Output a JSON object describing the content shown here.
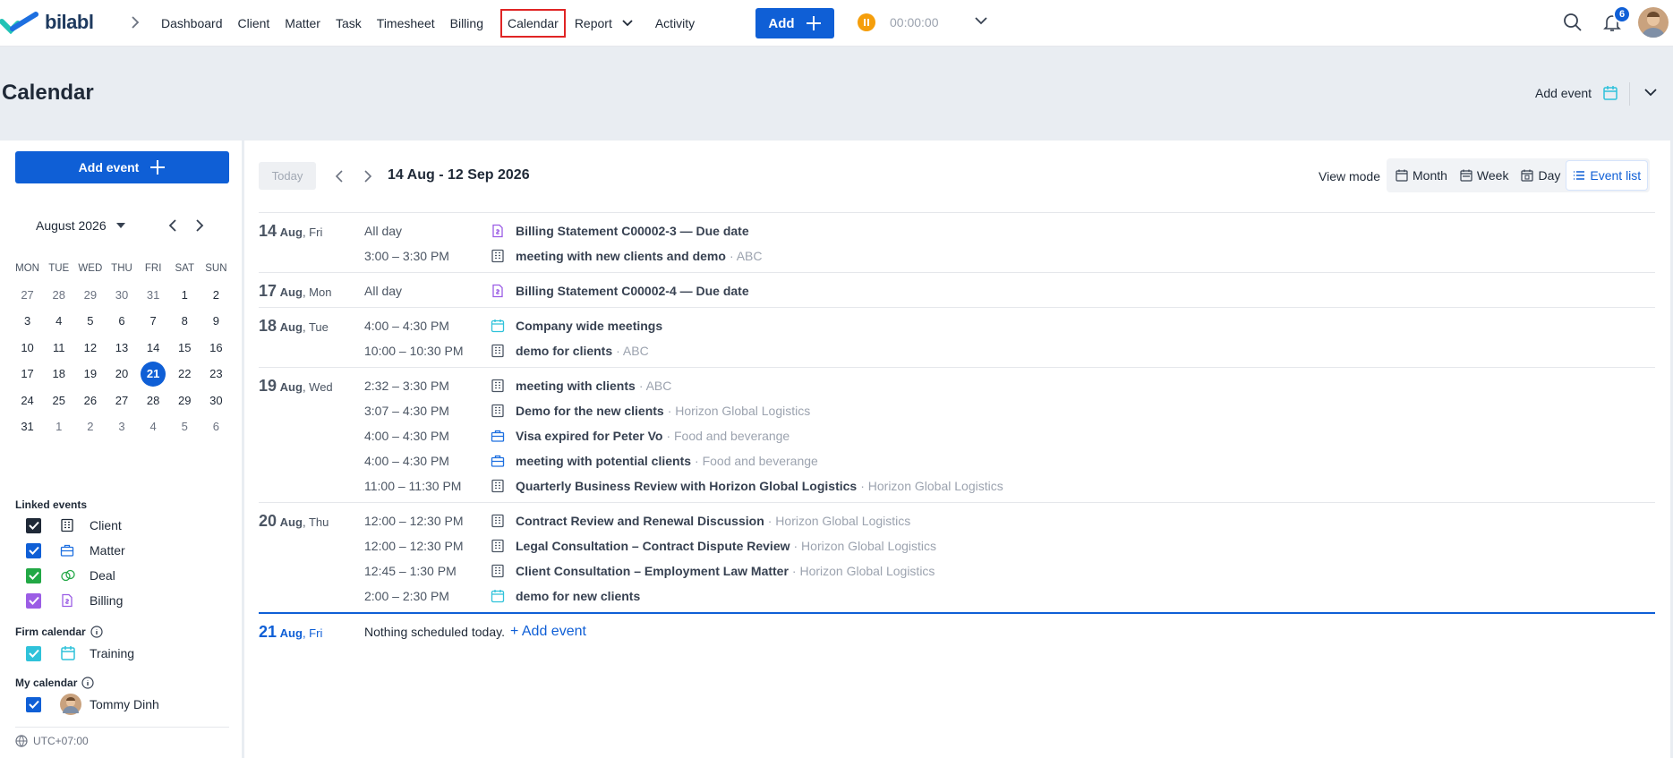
{
  "app": {
    "logo_text": "bilabl"
  },
  "nav": {
    "items": [
      {
        "label": "Dashboard"
      },
      {
        "label": "Client"
      },
      {
        "label": "Matter"
      },
      {
        "label": "Task"
      },
      {
        "label": "Timesheet"
      },
      {
        "label": "Billing"
      },
      {
        "label": "Calendar",
        "active": true
      },
      {
        "label": "Report",
        "has_dropdown": true
      },
      {
        "label": "Activity"
      }
    ],
    "add_label": "Add",
    "timer": "00:00:00",
    "notification_count": "6"
  },
  "page": {
    "title": "Calendar",
    "header_add_event": "Add event"
  },
  "sidebar": {
    "add_event_label": "Add event",
    "mini_calendar": {
      "month_label": "August 2026",
      "weekdays": [
        "MON",
        "TUE",
        "WED",
        "THU",
        "FRI",
        "SAT",
        "SUN"
      ],
      "weeks": [
        [
          "27",
          "28",
          "29",
          "30",
          "31",
          "1",
          "2"
        ],
        [
          "3",
          "4",
          "5",
          "6",
          "7",
          "8",
          "9"
        ],
        [
          "10",
          "11",
          "12",
          "13",
          "14",
          "15",
          "16"
        ],
        [
          "17",
          "18",
          "19",
          "20",
          "21",
          "22",
          "23"
        ],
        [
          "24",
          "25",
          "26",
          "27",
          "28",
          "29",
          "30"
        ],
        [
          "31",
          "1",
          "2",
          "3",
          "4",
          "5",
          "6"
        ]
      ],
      "today": "21"
    },
    "linked_events_label": "Linked events",
    "linked_events": [
      {
        "label": "Client",
        "color": "#1f2937",
        "icon": "building-icon"
      },
      {
        "label": "Matter",
        "color": "#0f5fd6",
        "icon": "briefcase-icon"
      },
      {
        "label": "Deal",
        "color": "#22a845",
        "icon": "deal-icon"
      },
      {
        "label": "Billing",
        "color": "#9b5de5",
        "icon": "invoice-icon"
      }
    ],
    "firm_calendar_label": "Firm calendar",
    "firm_calendar": [
      {
        "label": "Training",
        "color": "#2fc2da",
        "icon": "calendar-icon"
      }
    ],
    "my_calendar_label": "My calendar",
    "my_calendar": [
      {
        "label": "Tommy Dinh",
        "color": "#0f5fd6"
      }
    ],
    "timezone": "UTC+07:00"
  },
  "toolbar": {
    "today_label": "Today",
    "range_label": "14 Aug - 12 Sep 2026",
    "view_mode_label": "View mode",
    "view_modes": [
      {
        "label": "Month",
        "icon": "calendar-month-icon"
      },
      {
        "label": "Week",
        "icon": "calendar-week-icon"
      },
      {
        "label": "Day",
        "icon": "calendar-day-icon"
      },
      {
        "label": "Event list",
        "icon": "list-icon",
        "active": true
      }
    ]
  },
  "days": [
    {
      "day": "14",
      "month": "Aug",
      "weekday": "Fri",
      "events": [
        {
          "time": "All day",
          "type": "billing",
          "title": "Billing Statement C00002-3 — Due date",
          "sub": ""
        },
        {
          "time": "3:00 – 3:30 PM",
          "type": "client",
          "title": "meeting with new clients and demo",
          "sub": "· ABC"
        }
      ]
    },
    {
      "day": "17",
      "month": "Aug",
      "weekday": "Mon",
      "events": [
        {
          "time": "All day",
          "type": "billing",
          "title": "Billing Statement C00002-4 — Due date",
          "sub": ""
        }
      ]
    },
    {
      "day": "18",
      "month": "Aug",
      "weekday": "Tue",
      "events": [
        {
          "time": "4:00 – 4:30 PM",
          "type": "training",
          "title": "Company wide meetings",
          "sub": ""
        },
        {
          "time": "10:00 – 10:30 PM",
          "type": "client",
          "title": "demo for clients",
          "sub": "· ABC"
        }
      ]
    },
    {
      "day": "19",
      "month": "Aug",
      "weekday": "Wed",
      "events": [
        {
          "time": "2:32 – 3:30 PM",
          "type": "client",
          "title": "meeting with clients",
          "sub": "· ABC"
        },
        {
          "time": "3:07 – 4:30 PM",
          "type": "client",
          "title": "Demo for the new clients",
          "sub": "· Horizon Global Logistics"
        },
        {
          "time": "4:00 – 4:30 PM",
          "type": "matter",
          "title": "Visa expired for Peter Vo",
          "sub": "· Food and beverange"
        },
        {
          "time": "4:00 – 4:30 PM",
          "type": "matter",
          "title": "meeting with potential clients",
          "sub": "· Food and beverange"
        },
        {
          "time": "11:00 – 11:30 PM",
          "type": "client",
          "title": "Quarterly Business Review with Horizon Global Logistics",
          "sub": "· Horizon Global Logistics"
        }
      ]
    },
    {
      "day": "20",
      "month": "Aug",
      "weekday": "Thu",
      "events": [
        {
          "time": "12:00 – 12:30 PM",
          "type": "client",
          "title": "Contract Review and Renewal Discussion",
          "sub": "· Horizon Global Logistics"
        },
        {
          "time": "12:00 – 12:30 PM",
          "type": "client",
          "title": "Legal Consultation – Contract Dispute Review",
          "sub": "· Horizon Global Logistics"
        },
        {
          "time": "12:45 – 1:30 PM",
          "type": "client",
          "title": "Client Consultation – Employment Law Matter",
          "sub": "· Horizon Global Logistics"
        },
        {
          "time": "2:00 – 2:30 PM",
          "type": "training",
          "title": "demo for new clients",
          "sub": ""
        }
      ]
    }
  ],
  "today_block": {
    "day": "21",
    "month": "Aug",
    "weekday": "Fri",
    "nothing_text": "Nothing scheduled today.",
    "add_event_label": "+ Add event"
  }
}
